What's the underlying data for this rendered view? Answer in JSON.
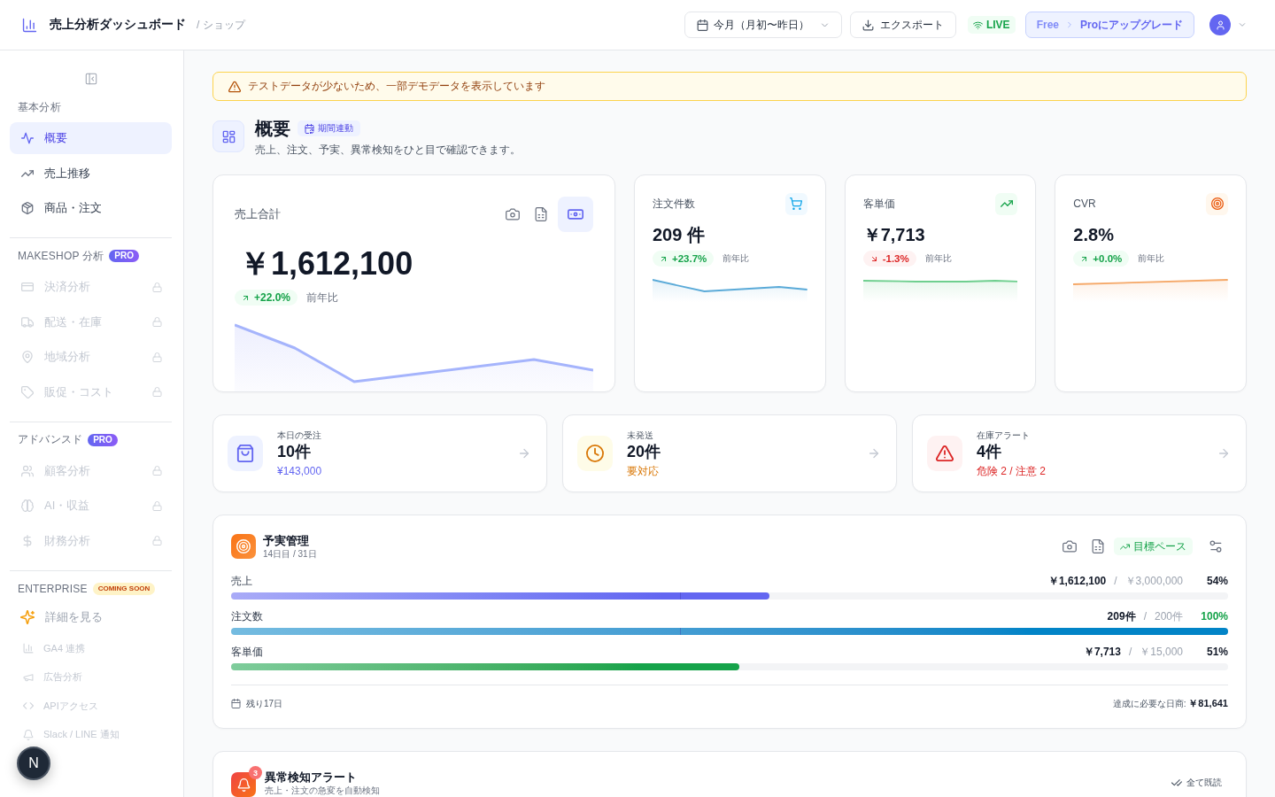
{
  "header": {
    "title": "売上分析ダッシュボード",
    "breadcrumb": "/ ショップ",
    "date_range": "今月（月初〜昨日）",
    "export_button": "エクスポート",
    "live_badge": "LIVE",
    "plan": {
      "current": "Free",
      "upgrade": "Proにアップグレード"
    }
  },
  "sidebar": {
    "sections": [
      {
        "label": "基本分析",
        "items": [
          {
            "label": "概要",
            "kind": "nav",
            "selected": true,
            "locked": false
          },
          {
            "label": "売上推移",
            "kind": "nav",
            "selected": false,
            "locked": false
          },
          {
            "label": "商品・注文",
            "kind": "nav",
            "selected": false,
            "locked": false
          }
        ]
      },
      {
        "label": "MAKESHOP 分析",
        "badge": {
          "text": "PRO",
          "kind": "pro"
        },
        "items": [
          {
            "label": "決済分析",
            "kind": "nav",
            "selected": false,
            "locked": true
          },
          {
            "label": "配送・在庫",
            "kind": "nav",
            "selected": false,
            "locked": true
          },
          {
            "label": "地域分析",
            "kind": "nav",
            "selected": false,
            "locked": true
          },
          {
            "label": "販促・コスト",
            "kind": "nav",
            "selected": false,
            "locked": true
          }
        ]
      },
      {
        "label": "アドバンスド",
        "badge": {
          "text": "PRO",
          "kind": "pro"
        },
        "items": [
          {
            "label": "顧客分析",
            "kind": "nav",
            "selected": false,
            "locked": true
          },
          {
            "label": "AI・収益",
            "kind": "nav",
            "selected": false,
            "locked": true
          },
          {
            "label": "財務分析",
            "kind": "nav",
            "selected": false,
            "locked": true
          }
        ]
      },
      {
        "label": "ENTERPRISE",
        "badge": {
          "text": "COMING SOON",
          "kind": "soon"
        },
        "items": [
          {
            "label": "詳細を見る",
            "kind": "link"
          },
          {
            "label": "GA4 連携",
            "kind": "planned"
          },
          {
            "label": "広告分析",
            "kind": "planned"
          },
          {
            "label": "APIアクセス",
            "kind": "planned"
          },
          {
            "label": "Slack / LINE 通知",
            "kind": "planned"
          }
        ]
      }
    ]
  },
  "dev_indicator": "N",
  "notice": "テストデータが少ないため、一部デモデータを表示しています",
  "page": {
    "title": "概要",
    "badge": "期間連動",
    "subtitle": "売上、注文、予実、異常検知をひと目で確認できます。"
  },
  "hero_kpi": {
    "label": "売上合計",
    "value": "￥1,612,100",
    "change": "+22.0%",
    "positive": true,
    "comparison": "前年比"
  },
  "kpis": [
    {
      "label": "注文件数",
      "value": "209 件",
      "change": "+23.7%",
      "positive": true,
      "comparison": "前年比",
      "kind": "orders"
    },
    {
      "label": "客単価",
      "value": "￥7,713",
      "change": "-1.3%",
      "positive": false,
      "comparison": "前年比",
      "kind": "basket"
    },
    {
      "label": "CVR",
      "value": "2.8%",
      "change": "+0.0%",
      "positive": true,
      "comparison": "前年比",
      "kind": "conversion"
    }
  ],
  "quick_stats": [
    {
      "label": "本日の受注",
      "value": "10件",
      "detail": "¥143,000",
      "kind": "info"
    },
    {
      "label": "未発送",
      "value": "20件",
      "detail": "要対応",
      "kind": "warning"
    },
    {
      "label": "在庫アラート",
      "value": "4件",
      "detail": "危険 2 / 注意 2",
      "kind": "danger"
    }
  ],
  "budget": {
    "title": "予実管理",
    "subtitle": "14日目 / 31日",
    "pace_button": "目標ペース",
    "rows": [
      {
        "label": "売上",
        "actual": "￥1,612,100",
        "separator": "/",
        "target": "￥3,000,000",
        "percent": "54%",
        "achieved": false,
        "level": 0.54,
        "color": "#6366f1",
        "pace_marker": {
          "level": 0.45
        }
      },
      {
        "label": "注文数",
        "actual": "209件",
        "separator": "/",
        "target": "200件",
        "percent": "100%",
        "achieved": true,
        "level": 1,
        "color": "#0284c7",
        "pace_marker": {
          "level": 0.45
        }
      },
      {
        "label": "客単価",
        "actual": "￥7,713",
        "separator": "/",
        "target": "￥15,000",
        "percent": "51%",
        "achieved": false,
        "level": 0.51,
        "color": "#16a34a"
      }
    ],
    "remaining": "残り17日",
    "required_daily": "達成に必要な日商: **￥81,641**"
  },
  "anomaly_alerts": {
    "title": "異常検知アラート",
    "subtitle": "売上・注文の急変を自動検知",
    "count": "3",
    "mark_all_read": "全て既読"
  }
}
